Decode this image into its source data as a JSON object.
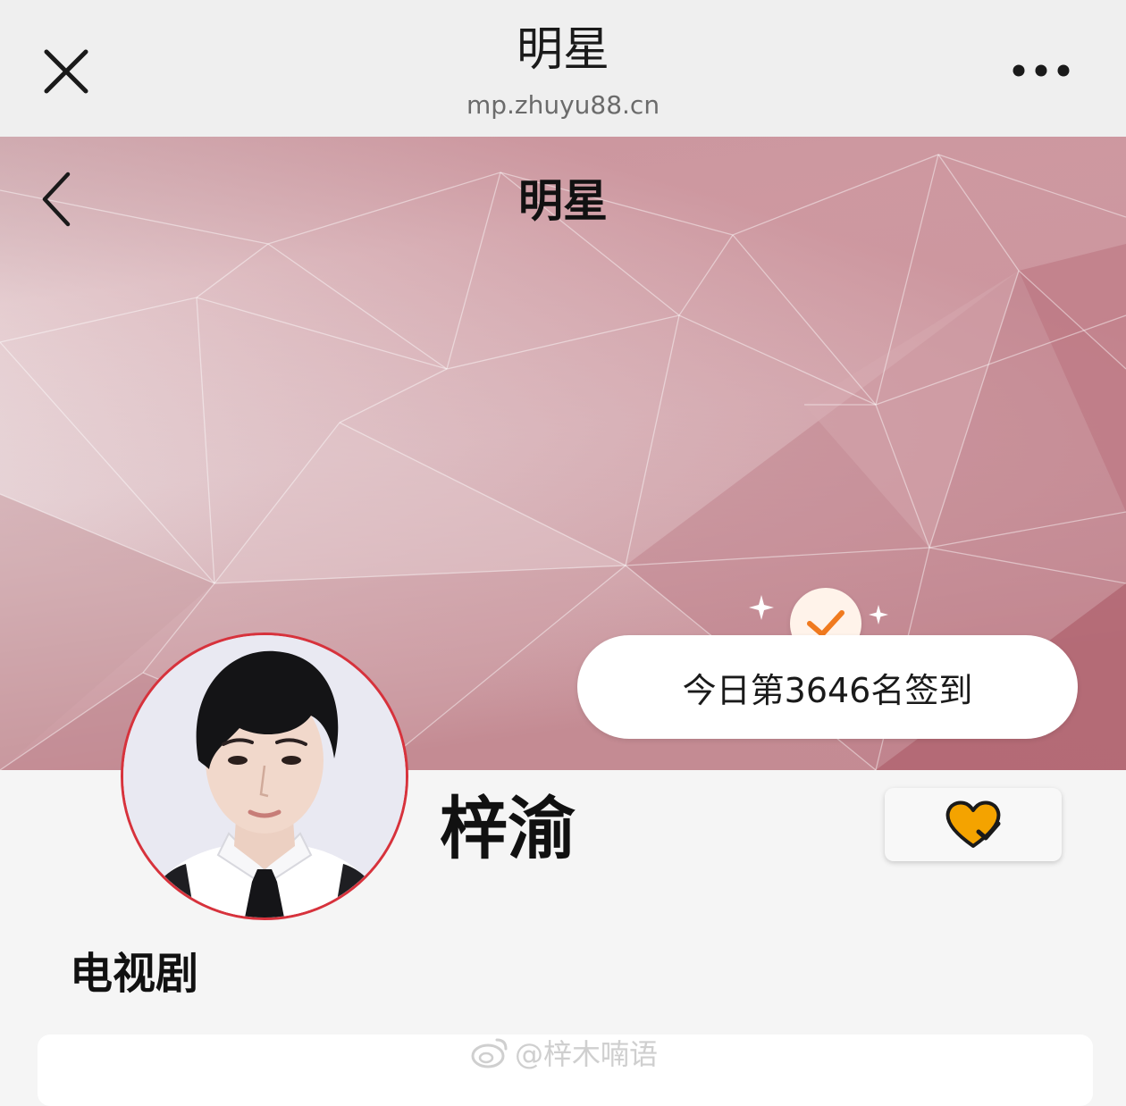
{
  "browser": {
    "title": "明星",
    "url": "mp.zhuyu88.cn",
    "close_icon": "close-icon",
    "more_icon": "more-dots-icon"
  },
  "page": {
    "title": "明星",
    "back_icon": "chevron-left-icon"
  },
  "checkin": {
    "text": "今日第3646名签到",
    "icon": "checkmark-icon",
    "accent_color": "#f07a1f"
  },
  "star": {
    "name": "梓渝",
    "follow_icon": "heart-check-icon",
    "follow_color": "#f4a300"
  },
  "section": {
    "title": "电视剧"
  },
  "watermark": {
    "text": "@梓木喃语",
    "icon": "weibo-icon"
  }
}
